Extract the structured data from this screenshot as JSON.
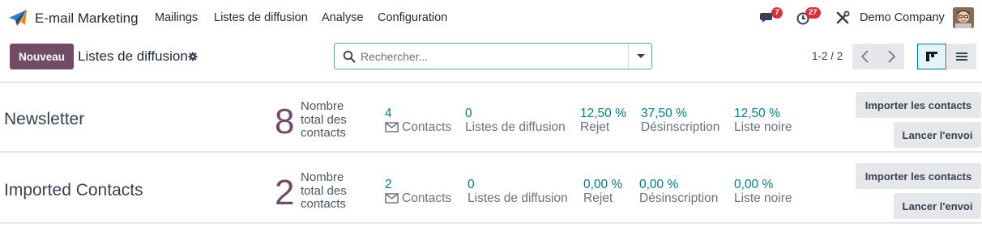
{
  "app": {
    "name": "E-mail Marketing",
    "menu": [
      "Mailings",
      "Listes de diffusion",
      "Analyse",
      "Configuration"
    ],
    "messages_badge": "7",
    "activities_badge": "27",
    "company": "Demo Company"
  },
  "control": {
    "new_label": "Nouveau",
    "title": "Listes de diffusion",
    "search_placeholder": "Rechercher...",
    "pager": "1-2 / 2"
  },
  "lists": [
    {
      "name": "Newsletter",
      "total": "8",
      "total_label": "Nombre total des contacts",
      "contacts": "4",
      "contacts_label": "Contacts",
      "mailing_lists": "0",
      "mailing_lists_label": "Listes de diffusion",
      "bounce": "12,50 %",
      "bounce_label": "Rejet",
      "unsub": "37,50 %",
      "unsub_label": "Désinscription",
      "blacklist": "12,50 %",
      "blacklist_label": "Liste noire",
      "import_label": "Importer les contacts",
      "send_label": "Lancer l'envoi"
    },
    {
      "name": "Imported Contacts",
      "total": "2",
      "total_label": "Nombre total des contacts",
      "contacts": "2",
      "contacts_label": "Contacts",
      "mailing_lists": "0",
      "mailing_lists_label": "Listes de diffusion",
      "bounce": "0,00 %",
      "bounce_label": "Rejet",
      "unsub": "0,00 %",
      "unsub_label": "Désinscription",
      "blacklist": "0,00 %",
      "blacklist_label": "Liste noire",
      "import_label": "Importer les contacts",
      "send_label": "Lancer l'envoi"
    }
  ]
}
